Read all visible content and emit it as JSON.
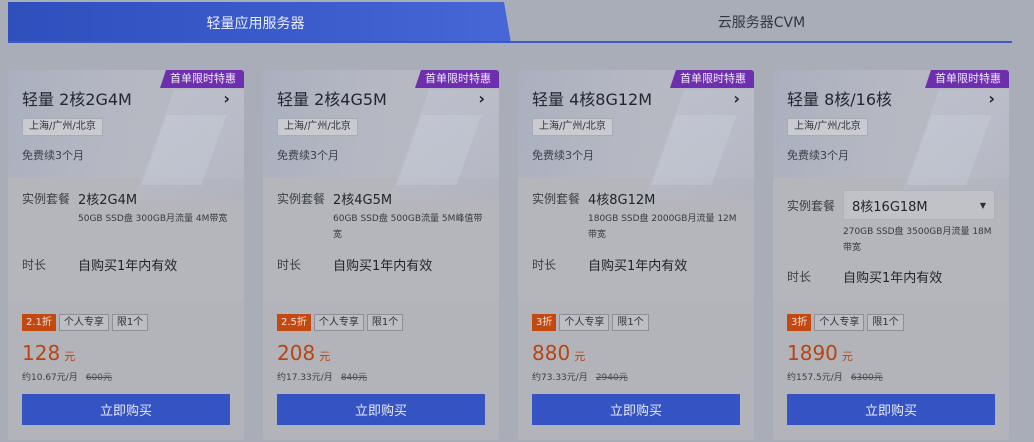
{
  "tabs": {
    "active_label": "轻量应用服务器",
    "inactive_label": "云服务器CVM"
  },
  "labels": {
    "plan": "实例套餐",
    "duration": "时长",
    "buy": "立即购买"
  },
  "cards": [
    {
      "badge": "首单限时特惠",
      "title": "轻量 2核2G4M",
      "region": "上海/广州/北京",
      "renew": "免费续3个月",
      "plan_value": "2核2G4M",
      "plan_desc": "50GB SSD盘 300GB月流量 4M带宽",
      "duration_value": "自购买1年内有效",
      "discount": "2.1折",
      "tag1": "个人专享",
      "tag2": "限1个",
      "price": "128",
      "unit": "元",
      "monthly": "约10.67元/月",
      "original": "600元"
    },
    {
      "badge": "首单限时特惠",
      "title": "轻量 2核4G5M",
      "region": "上海/广州/北京",
      "renew": "免费续3个月",
      "plan_value": "2核4G5M",
      "plan_desc": "60GB SSD盘 500GB流量 5M峰值带宽",
      "duration_value": "自购买1年内有效",
      "discount": "2.5折",
      "tag1": "个人专享",
      "tag2": "限1个",
      "price": "208",
      "unit": "元",
      "monthly": "约17.33元/月",
      "original": "840元"
    },
    {
      "badge": "首单限时特惠",
      "title": "轻量 4核8G12M",
      "region": "上海/广州/北京",
      "renew": "免费续3个月",
      "plan_value": "4核8G12M",
      "plan_desc": "180GB SSD盘 2000GB月流量 12M带宽",
      "duration_value": "自购买1年内有效",
      "discount": "3折",
      "tag1": "个人专享",
      "tag2": "限1个",
      "price": "880",
      "unit": "元",
      "monthly": "约73.33元/月",
      "original": "2940元"
    },
    {
      "badge": "首单限时特惠",
      "title": "轻量 8核/16核",
      "region": "上海/广州/北京",
      "renew": "免费续3个月",
      "plan_value": "8核16G18M",
      "plan_desc": "270GB SSD盘 3500GB月流量 18M带宽",
      "duration_value": "自购买1年内有效",
      "discount": "3折",
      "tag1": "个人专享",
      "tag2": "限1个",
      "price": "1890",
      "unit": "元",
      "monthly": "约157.5元/月",
      "original": "6300元"
    }
  ]
}
